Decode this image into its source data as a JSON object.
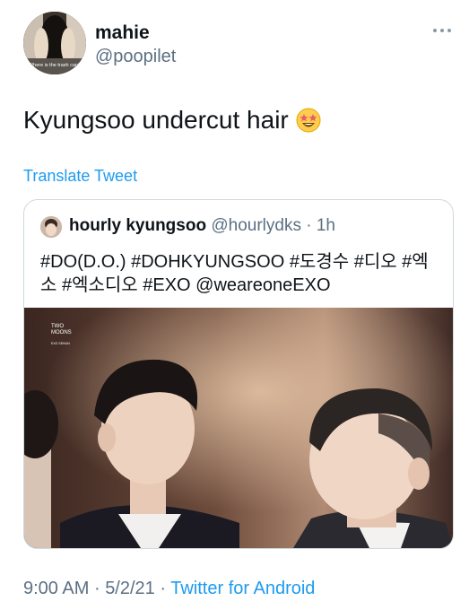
{
  "author": {
    "display_name": "mahie",
    "handle": "@poopilet",
    "avatar_caption": "Where is the trash can?"
  },
  "tweet": {
    "text": "Kyungsoo undercut hair",
    "emoji": "star-struck-emoji",
    "translate_label": "Translate Tweet"
  },
  "quoted_tweet": {
    "display_name": "hourly kyungsoo",
    "handle": "@hourlydks",
    "separator": "·",
    "time": "1h",
    "text_line1": "#DO(D.O.) #DOHKYUNGSOO #도경수 #디오 #엑",
    "text_line2": "소 #엑소디오 #EXO @weareoneEXO",
    "image_watermark_line1": "TWO",
    "image_watermark_line2": "MOONS",
    "image_watermark_line3": "EXO SEHUN"
  },
  "footer": {
    "time": "9:00 AM",
    "sep1": "·",
    "date": "5/2/21",
    "sep2": "·",
    "source": "Twitter for Android"
  },
  "colors": {
    "link": "#1d9bf0",
    "secondary_text": "#5b7083",
    "border": "#cfd9de"
  }
}
